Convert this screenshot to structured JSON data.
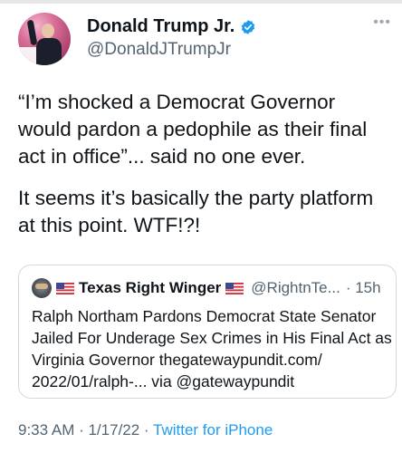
{
  "author": {
    "name": "Donald Trump Jr.",
    "handle": "@DonaldJTrumpJr",
    "avatar_icon": "profile-photo",
    "verified_icon": "verified-badge-icon"
  },
  "more_icon": "more-options-icon",
  "tweet": {
    "paragraph1": "“I’m shocked a Democrat Governor would pardon a pedophile as their final act in office”... said no one ever.",
    "paragraph2": "It seems it’s basically the party platform at this point. WTF!?!"
  },
  "quoted_tweet": {
    "name": "Texas Right Winger",
    "handle": "@RightnTe...",
    "time": "· 15h",
    "text": "Ralph Northam Pardons Democrat State Senator Jailed For Underage Sex Crimes in His Final Act as Virginia Governor thegatewaypundit.com/ 2022/01/ralph-... via @gatewaypundit"
  },
  "footer": {
    "timestamp": "9:33 AM · 1/17/22 · ",
    "source": "Twitter for iPhone"
  },
  "colors": {
    "accent": "#1d9bf0",
    "muted": "#536471",
    "text": "#0f1419"
  }
}
